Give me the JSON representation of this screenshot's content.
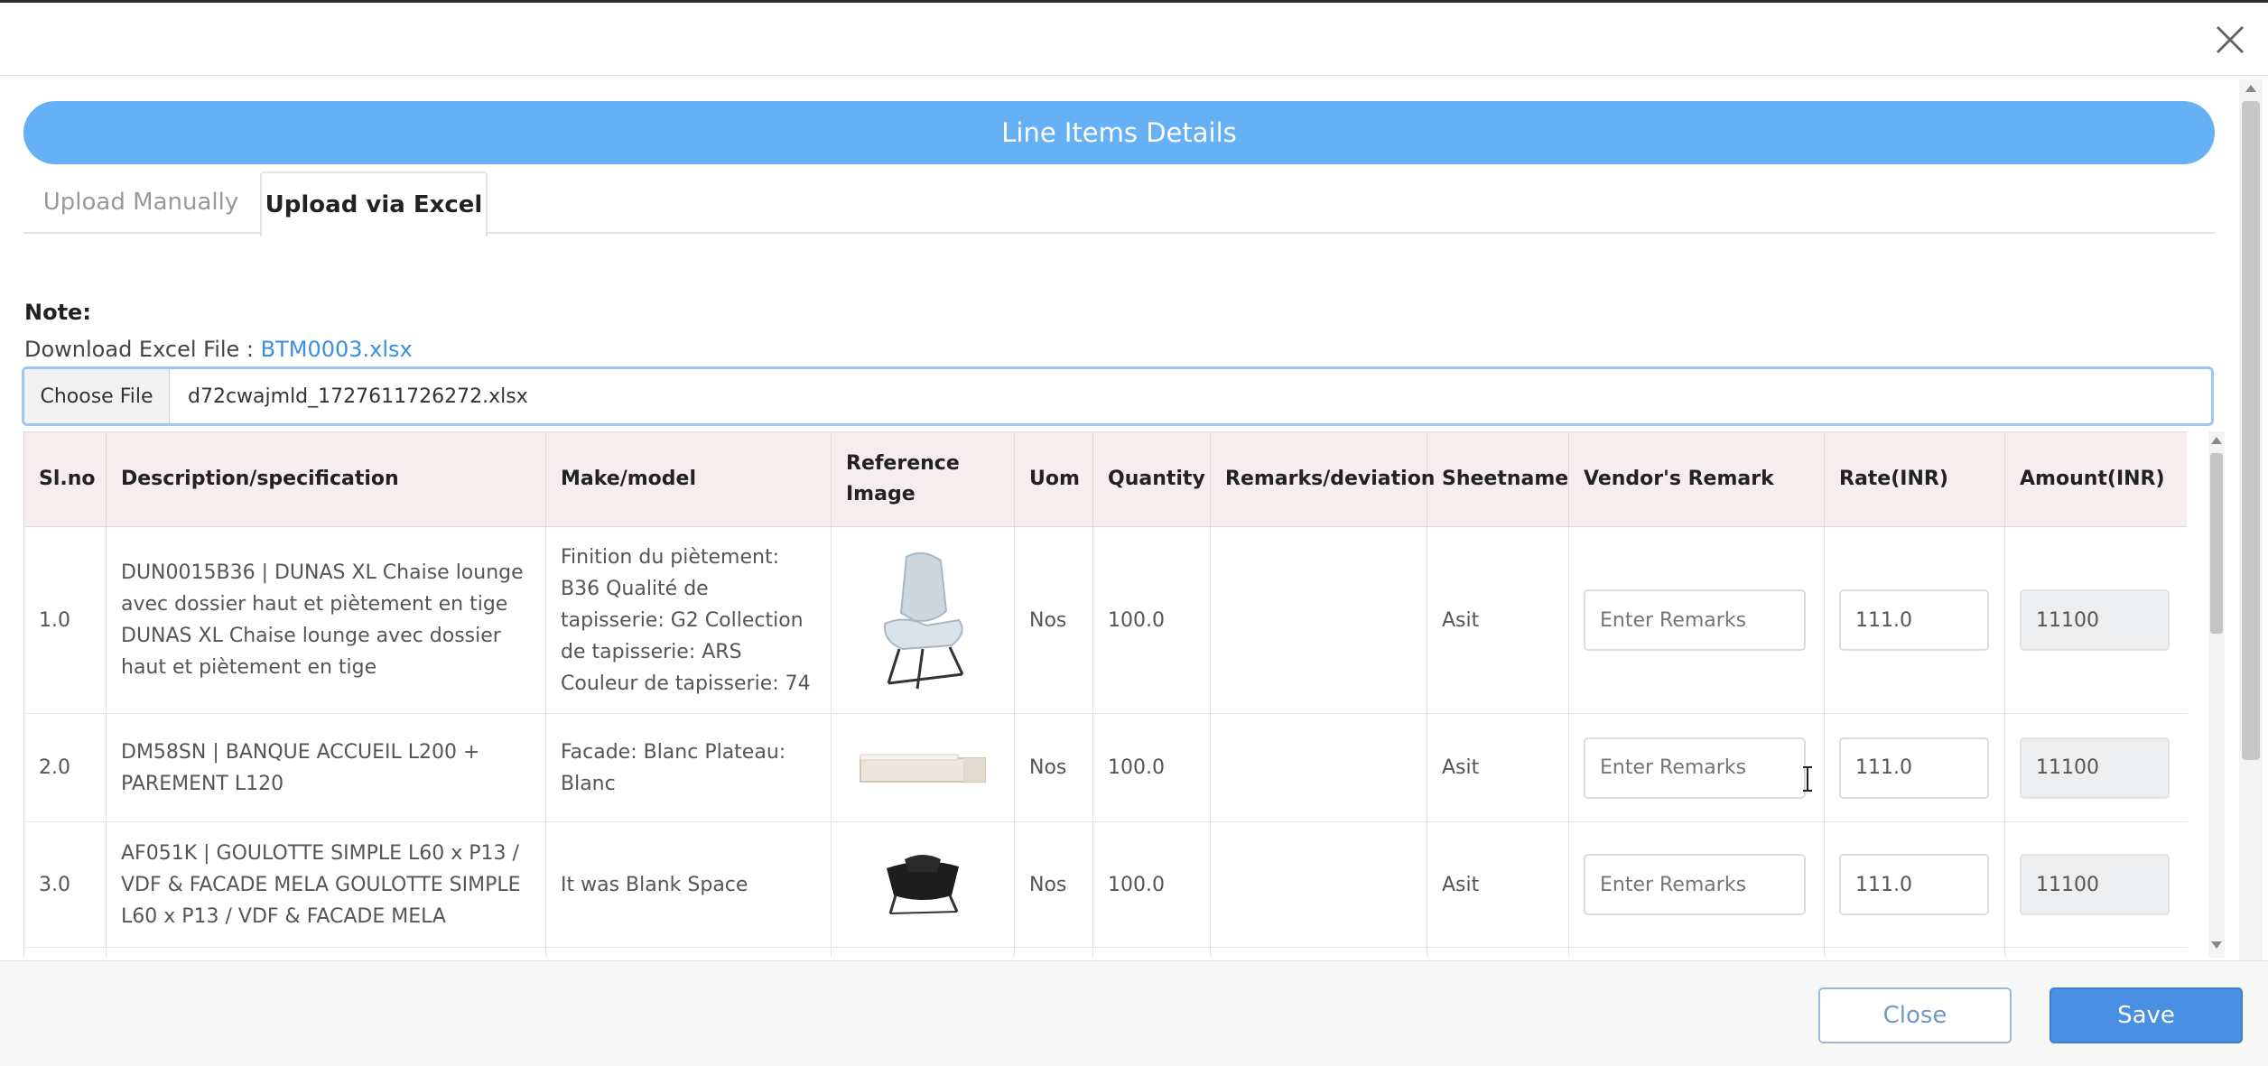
{
  "modal": {
    "close_icon": "close-icon"
  },
  "banner": {
    "title": "Line Items Details"
  },
  "tabs": [
    {
      "label": "Upload Manually",
      "active": false
    },
    {
      "label": "Upload via Excel",
      "active": true
    }
  ],
  "note": {
    "heading": "Note:",
    "download_label": "Download Excel File : ",
    "download_link": "BTM0003.xlsx"
  },
  "file_input": {
    "button_label": "Choose File",
    "file_name": "d72cwajmld_1727611726272.xlsx"
  },
  "table": {
    "headers": {
      "slno": "Sl.no",
      "description": "Description/specification",
      "make": "Make/model",
      "reference": "Reference Image",
      "uom": "Uom",
      "quantity": "Quantity",
      "remarks": "Remarks/deviation",
      "sheetname": "Sheetname",
      "vendor_remark": "Vendor's Remark",
      "rate": "Rate(INR)",
      "amount": "Amount(INR)"
    },
    "rows": [
      {
        "slno": "1.0",
        "description": "DUN0015B36 | DUNAS XL Chaise lounge avec dossier haut et piètement en tige DUNAS XL Chaise lounge avec dossier haut et piètement en tige",
        "make": "Finition du piètement: B36 Qualité de tapisserie: G2 Collection de tapisserie: ARS Couleur de tapisserie: 74",
        "image": "lounge-chair-image",
        "uom": "Nos",
        "quantity": "100.0",
        "remarks": "",
        "sheetname": "Asit",
        "vendor_remark_placeholder": "Enter Remarks",
        "rate": "111.0",
        "amount": "11100"
      },
      {
        "slno": "2.0",
        "description": "DM58SN | BANQUE ACCUEIL L200 + PAREMENT L120",
        "make": "Facade: Blanc Plateau: Blanc",
        "image": "reception-desk-image",
        "uom": "Nos",
        "quantity": "100.0",
        "remarks": "",
        "sheetname": "Asit",
        "vendor_remark_placeholder": "Enter Remarks",
        "rate": "111.0",
        "amount": "11100"
      },
      {
        "slno": "3.0",
        "description": "AF051K | GOULOTTE SIMPLE L60 x P13 / VDF & FACADE MELA GOULOTTE SIMPLE L60 x P13 / VDF & FACADE MELA",
        "make": "It was Blank Space",
        "image": "black-chair-image",
        "uom": "Nos",
        "quantity": "100.0",
        "remarks": "",
        "sheetname": "Asit",
        "vendor_remark_placeholder": "Enter Remarks",
        "rate": "111.0",
        "amount": "11100"
      }
    ]
  },
  "footer": {
    "close_label": "Close",
    "save_label": "Save"
  },
  "colors": {
    "banner": "#66b0f5",
    "save": "#4a90e2",
    "link": "#3a8ee6",
    "header_bg": "#f6eeee"
  }
}
